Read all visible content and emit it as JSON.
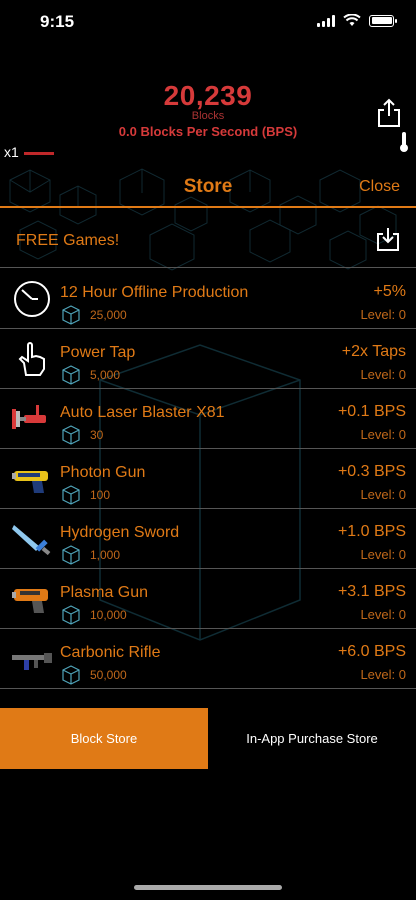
{
  "status": {
    "time": "9:15"
  },
  "header": {
    "block_count": "20,239",
    "blocks_label": "Blocks",
    "bps": "0.0 Blocks Per Second (BPS)",
    "multiplier": "x1"
  },
  "store": {
    "title": "Store",
    "close_label": "Close",
    "free_games_label": "FREE Games!",
    "items": [
      {
        "name": "12 Hour Offline Production",
        "cost": "25,000",
        "effect": "+5%",
        "level": "Level: 0",
        "icon": "clock-icon"
      },
      {
        "name": "Power Tap",
        "cost": "5,000",
        "effect": "+2x Taps",
        "level": "Level: 0",
        "icon": "tap-hand-icon"
      },
      {
        "name": "Auto Laser Blaster X81",
        "cost": "30",
        "effect": "+0.1 BPS",
        "level": "Level: 0",
        "icon": "laser-blaster-icon"
      },
      {
        "name": "Photon Gun",
        "cost": "100",
        "effect": "+0.3 BPS",
        "level": "Level: 0",
        "icon": "photon-gun-icon"
      },
      {
        "name": "Hydrogen Sword",
        "cost": "1,000",
        "effect": "+1.0 BPS",
        "level": "Level: 0",
        "icon": "sword-icon"
      },
      {
        "name": "Plasma Gun",
        "cost": "10,000",
        "effect": "+3.1 BPS",
        "level": "Level: 0",
        "icon": "plasma-gun-icon"
      },
      {
        "name": "Carbonic Rifle",
        "cost": "50,000",
        "effect": "+6.0 BPS",
        "level": "Level: 0",
        "icon": "rifle-icon"
      }
    ]
  },
  "tabs": {
    "block_store": "Block Store",
    "iap_store": "In-App Purchase Store"
  },
  "colors": {
    "accent": "#e07a16",
    "count_red": "#d63a3a",
    "background": "#000000"
  }
}
